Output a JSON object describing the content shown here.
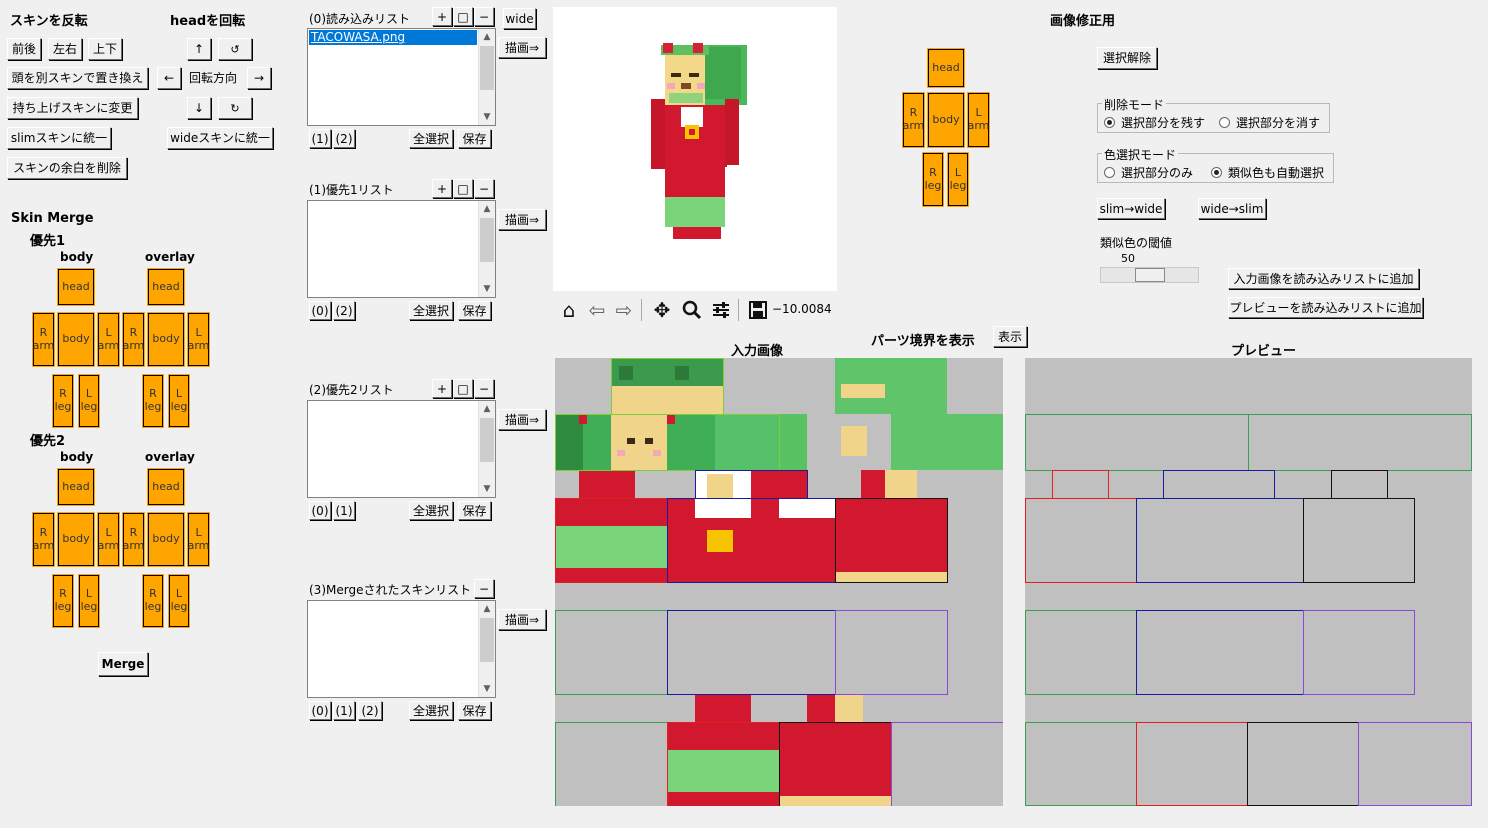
{
  "flip": {
    "title": "スキンを反転",
    "front_back": "前後",
    "left_right": "左右",
    "up_down": "上下",
    "replace_head": "頭を別スキンで置き換え",
    "raised": "持ち上げスキンに変更",
    "slim_unify": "slimスキンに統一",
    "wide_unify": "wideスキンに統一",
    "trim": "スキンの余白を削除"
  },
  "rotate": {
    "title": "headを回転",
    "up": "↑",
    "down": "↓",
    "left": "←",
    "right": "→",
    "ccw": "↺",
    "cw": "↻",
    "dir": "回転方向"
  },
  "merge": {
    "title": "Skin Merge",
    "p1": "優先1",
    "p2": "優先2",
    "body": "body",
    "overlay": "overlay",
    "merge_btn": "Merge"
  },
  "parts": {
    "head": "head",
    "body": "body",
    "rarm": "R\narm",
    "larm": "L\narm",
    "rleg": "R\nleg",
    "lleg": "L\nleg"
  },
  "lists": {
    "l0": {
      "title": "(0)読み込みリスト",
      "items": [
        "TACOWASA.png"
      ],
      "tabs": [
        "(1)",
        "(2)"
      ]
    },
    "l1": {
      "title": "(1)優先1リスト",
      "items": [],
      "tabs": [
        "(0)",
        "(2)"
      ]
    },
    "l2": {
      "title": "(2)優先2リスト",
      "items": [],
      "tabs": [
        "(0)",
        "(1)"
      ]
    },
    "l3": {
      "title": "(3)Mergeされたスキンリスト",
      "items": [],
      "tabs": [
        "(0)",
        "(1)",
        "(2)"
      ]
    },
    "plus": "+",
    "square": "□",
    "minus": "−",
    "select_all": "全選択",
    "save": "保存",
    "draw": "描画⇒",
    "wide": "wide"
  },
  "toolbar": {
    "coord": "−10.0084"
  },
  "center": {
    "boundary": "パーツ境界を表示",
    "show": "表示",
    "input": "入力画像",
    "preview": "プレビュー"
  },
  "edit": {
    "title": "画像修正用",
    "deselect": "選択解除",
    "delete_mode": "削除モード",
    "keep_sel": "選択部分を残す",
    "erase_sel": "選択部分を消す",
    "color_mode": "色選択モード",
    "sel_only": "選択部分のみ",
    "auto_similar": "類似色も自動選択",
    "slim_wide": "slim→wide",
    "wide_slim": "wide→slim",
    "threshold": "類似色の閾値",
    "threshold_val": "50",
    "threshold_level": 0.5,
    "add_input": "入力画像を読み込みリストに追加",
    "add_preview": "プレビューを読み込みリストに追加"
  },
  "colors": {
    "part": "#ffa500",
    "canvas": "#c0c0c0",
    "green": "#3cb371",
    "red": "#dc143c",
    "blue": "#1a1aa0",
    "purple": "#8a4ad8",
    "black": "#000000"
  }
}
